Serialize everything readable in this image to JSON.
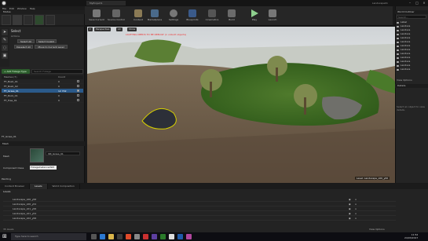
{
  "window": {
    "tab_title": "MyProject1",
    "level_name": "Landscape01"
  },
  "menu": [
    "File",
    "Edit",
    "Window",
    "Help"
  ],
  "modes": {
    "header": "Modes",
    "tool_title": "Select",
    "actions_label": "Actions",
    "buttons": [
      "Select All",
      "Select Invalid",
      "Deselect All",
      "Move to Current Level"
    ],
    "add_foliage_type": "+ Add Foliage Type",
    "search_placeholder": "Search Foliage",
    "table_headers": [
      "Meshes (7)",
      "Count"
    ],
    "foliage": [
      {
        "name": "FT_Bush_01",
        "count": "0"
      },
      {
        "name": "FT_Bush_02",
        "count": "0"
      },
      {
        "name": "FT_Grass_01",
        "count": "12 702"
      },
      {
        "name": "FT_Rock_01",
        "count": "0"
      },
      {
        "name": "FT_Tree_01",
        "count": "0"
      }
    ],
    "selected_label": "FT_Grass_01",
    "mesh_section": "Mesh",
    "mesh_label": "Mesh",
    "mesh_value": "SM_Grass_01",
    "component_label": "Component Class",
    "component_value": "FoliageInstancedSM",
    "painting_label": "Painting"
  },
  "toolbar": [
    {
      "label": "Save Current"
    },
    {
      "label": "Source Control"
    },
    {
      "label": "Content"
    },
    {
      "label": "Marketplace"
    },
    {
      "label": "Settings"
    },
    {
      "label": "Blueprints"
    },
    {
      "label": "Cinematics"
    },
    {
      "label": "Build"
    },
    {
      "label": "Play"
    },
    {
      "label": "Launch"
    }
  ],
  "viewport": {
    "chips": [
      "Perspective",
      "Lit",
      "Show"
    ],
    "warning": "LIGHTING NEEDS TO BE REBUILT (1 unbuilt objects)",
    "level_label": "Level: Landscape_x00_y00"
  },
  "world_outliner": {
    "header": "World Outliner",
    "search_placeholder": "Search...",
    "items": [
      "Label",
      "Landsca",
      "Landsca",
      "Landsca",
      "Landsca",
      "Landsca",
      "Landsca",
      "Landsca",
      "Landsca",
      "Landsca",
      "Landsca",
      "Landsca",
      "Landsca"
    ],
    "view_options": "View Options"
  },
  "details": {
    "header": "Details",
    "hint": "Select an object to view details."
  },
  "bottom_tabs": [
    "Content Browser",
    "Levels",
    "World Composition"
  ],
  "levels": {
    "title": "Levels",
    "rows": [
      "Landscape_x00_y00",
      "Landscape_x00_y01",
      "Landscape_x01_y00",
      "Landscape_x01_y01",
      "Landscape_x02_y00"
    ],
    "count": "35 levels",
    "view_options": "View Options"
  },
  "taskbar": {
    "search_placeholder": "Type here to search",
    "time": "11:52",
    "date": "24/03/2017"
  }
}
